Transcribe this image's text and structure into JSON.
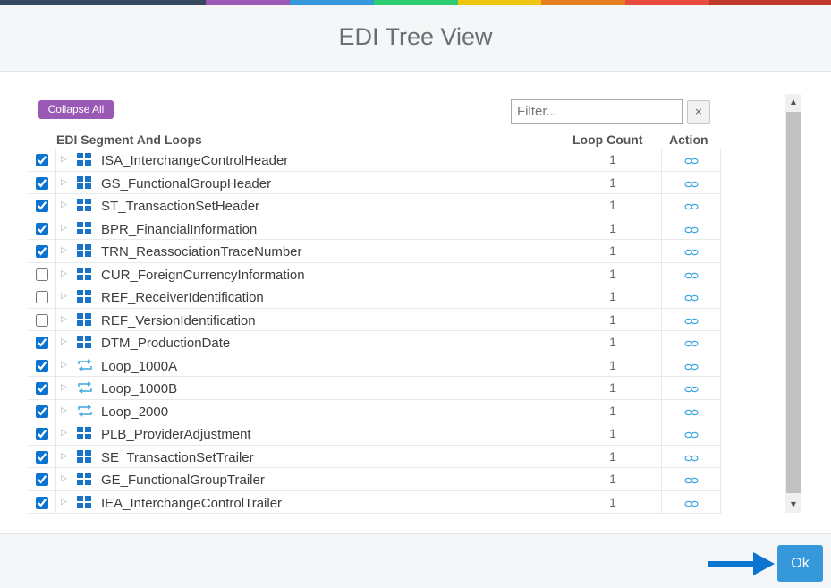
{
  "colors": {
    "top_stripes": [
      "#34495e",
      "#34495e",
      "#9b59b6",
      "#3498db",
      "#2ecc71",
      "#f1c40f",
      "#e67e22",
      "#e74c3c",
      "#c0392b"
    ],
    "collapse_button": "#9b59b6",
    "ok_button": "#3498db",
    "checkbox_accent": "#0b74d0",
    "segment_icon": "#1a73c8",
    "loop_icon": "#3aa6e0",
    "action_icon": "#3aa6e0",
    "pointer_arrow": "#0b74d0"
  },
  "dialog": {
    "title": "EDI Tree View"
  },
  "toolbar": {
    "collapse_all_label": "Collapse All",
    "filter_placeholder": "Filter...",
    "filter_value": "",
    "clear_filter_label": "×"
  },
  "table": {
    "headers": {
      "segment": "EDI Segment And Loops",
      "loop_count": "Loop Count",
      "action": "Action"
    },
    "rows": [
      {
        "checked": true,
        "icon": "segment-icon",
        "name": "ISA_InterchangeControlHeader",
        "loop_count": "1",
        "action_icon": "infinity-link-icon"
      },
      {
        "checked": true,
        "icon": "segment-icon",
        "name": "GS_FunctionalGroupHeader",
        "loop_count": "1",
        "action_icon": "infinity-link-icon"
      },
      {
        "checked": true,
        "icon": "segment-icon",
        "name": "ST_TransactionSetHeader",
        "loop_count": "1",
        "action_icon": "infinity-link-icon"
      },
      {
        "checked": true,
        "icon": "segment-icon",
        "name": "BPR_FinancialInformation",
        "loop_count": "1",
        "action_icon": "infinity-link-icon"
      },
      {
        "checked": true,
        "icon": "segment-icon",
        "name": "TRN_ReassociationTraceNumber",
        "loop_count": "1",
        "action_icon": "infinity-link-icon"
      },
      {
        "checked": false,
        "icon": "segment-icon",
        "name": "CUR_ForeignCurrencyInformation",
        "loop_count": "1",
        "action_icon": "infinity-link-icon"
      },
      {
        "checked": false,
        "icon": "segment-icon",
        "name": "REF_ReceiverIdentification",
        "loop_count": "1",
        "action_icon": "infinity-link-icon"
      },
      {
        "checked": false,
        "icon": "segment-icon",
        "name": "REF_VersionIdentification",
        "loop_count": "1",
        "action_icon": "infinity-link-icon"
      },
      {
        "checked": true,
        "icon": "segment-icon",
        "name": "DTM_ProductionDate",
        "loop_count": "1",
        "action_icon": "infinity-link-icon"
      },
      {
        "checked": true,
        "icon": "loop-icon",
        "name": "Loop_1000A",
        "loop_count": "1",
        "action_icon": "infinity-link-icon"
      },
      {
        "checked": true,
        "icon": "loop-icon",
        "name": "Loop_1000B",
        "loop_count": "1",
        "action_icon": "infinity-link-icon"
      },
      {
        "checked": true,
        "icon": "loop-icon",
        "name": "Loop_2000",
        "loop_count": "1",
        "action_icon": "infinity-link-icon"
      },
      {
        "checked": true,
        "icon": "segment-icon",
        "name": "PLB_ProviderAdjustment",
        "loop_count": "1",
        "action_icon": "infinity-link-icon"
      },
      {
        "checked": true,
        "icon": "segment-icon",
        "name": "SE_TransactionSetTrailer",
        "loop_count": "1",
        "action_icon": "infinity-link-icon"
      },
      {
        "checked": true,
        "icon": "segment-icon",
        "name": "GE_FunctionalGroupTrailer",
        "loop_count": "1",
        "action_icon": "infinity-link-icon"
      },
      {
        "checked": true,
        "icon": "segment-icon",
        "name": "IEA_InterchangeControlTrailer",
        "loop_count": "1",
        "action_icon": "infinity-link-icon"
      }
    ]
  },
  "scrollbar": {
    "up_icon": "▲",
    "down_icon": "▼"
  },
  "footer": {
    "ok_label": "Ok"
  }
}
